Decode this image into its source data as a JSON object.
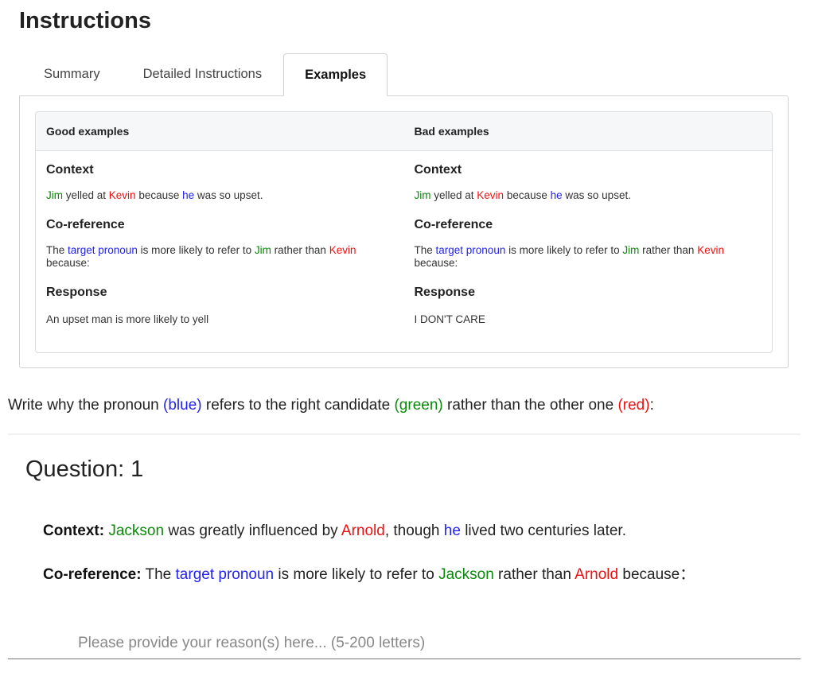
{
  "title": "Instructions",
  "tabs": [
    "Summary",
    "Detailed Instructions",
    "Examples"
  ],
  "examples": {
    "good_header": "Good examples",
    "bad_header": "Bad examples",
    "labels": {
      "context": "Context",
      "coreference": "Co-reference",
      "response": "Response"
    },
    "context": {
      "candidate1": "Jim",
      "t1": " yelled at ",
      "candidate2": "Kevin",
      "t2": " because ",
      "pronoun": "he",
      "t3": " was so upset."
    },
    "coreference": {
      "t1": "The ",
      "pronoun": "target pronoun",
      "t2": " is more likely to refer to ",
      "candidate1": "Jim",
      "t3": " rather than ",
      "candidate2": "Kevin",
      "t4": " because:"
    },
    "good_response": "An upset man is more likely to yell",
    "bad_response": "I DON'T CARE"
  },
  "instruction": {
    "t1": "Write why the pronoun ",
    "blue": "(blue)",
    "t2": " refers to the right candidate ",
    "green": "(green)",
    "t3": " rather than the other one ",
    "red": "(red)",
    "t4": ":"
  },
  "question": {
    "title": "Question: 1",
    "context_label": "Context:",
    "context": {
      "candidate1": "Jackson",
      "t1": " was greatly influenced by ",
      "candidate2": "Arnold",
      "t2": ", though ",
      "pronoun": "he",
      "t3": " lived two centuries later."
    },
    "coref_label": "Co-reference:",
    "coref": {
      "t1": " The ",
      "pronoun": "target pronoun",
      "t2": " is more likely to refer to ",
      "candidate1": "Jackson",
      "t3": " rather than ",
      "candidate2": "Arnold",
      "t4": " because："
    },
    "answer_placeholder": "Please provide your reason(s) here... (5-200 letters)",
    "answer_value": ""
  },
  "colors": {
    "candidate_correct": "#0a8a0a",
    "candidate_other": "#ee1111",
    "pronoun": "#2323ee"
  }
}
